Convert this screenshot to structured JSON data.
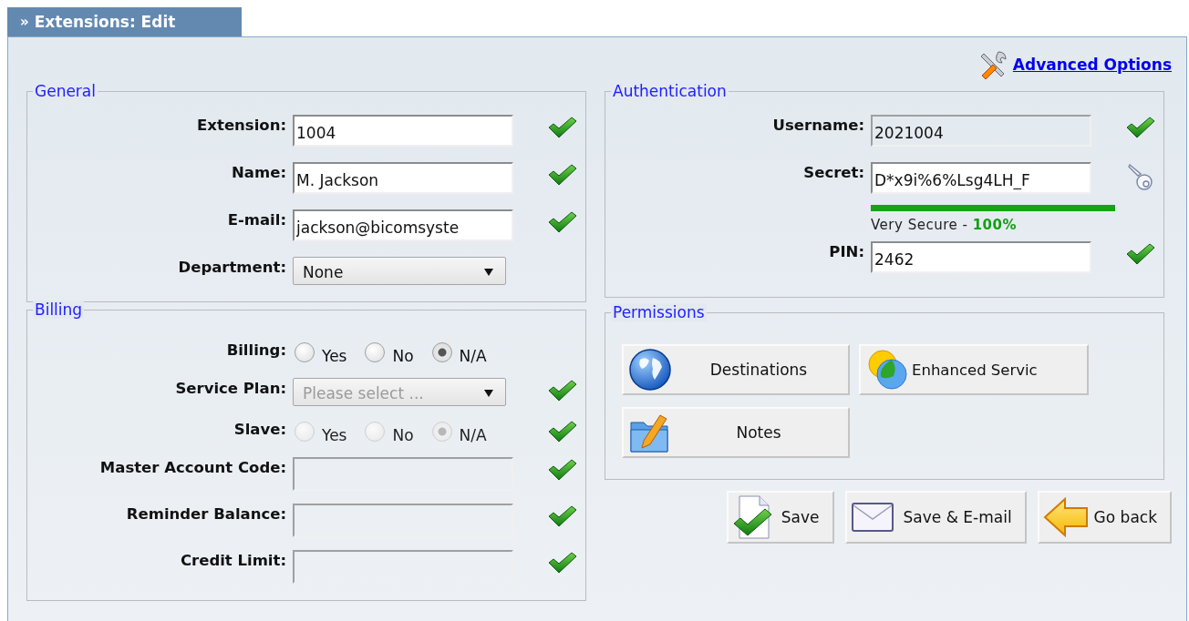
{
  "header": {
    "marker": "»",
    "title": "Extensions: Edit"
  },
  "advanced_link": {
    "label": "Advanced Options"
  },
  "general": {
    "legend": "General",
    "fields": [
      {
        "kind": "text",
        "label": "Extension:",
        "value": "1004",
        "disabled": false,
        "valid": true
      },
      {
        "kind": "text",
        "label": "Name:",
        "value": "M. Jackson",
        "disabled": false,
        "valid": true
      },
      {
        "kind": "text",
        "label": "E-mail:",
        "value": "jackson@bicomsyste",
        "disabled": false,
        "valid": true
      },
      {
        "kind": "select",
        "label": "Department:",
        "value": "None",
        "disabled": false,
        "valid": false
      }
    ]
  },
  "billing": {
    "legend": "Billing",
    "fields": [
      {
        "kind": "radio",
        "label": "Billing:",
        "disabled": false,
        "valid": false,
        "options": [
          {
            "label": "Yes",
            "selected": false
          },
          {
            "label": "No",
            "selected": false
          },
          {
            "label": "N/A",
            "selected": true
          }
        ]
      },
      {
        "kind": "select",
        "label": "Service Plan:",
        "placeholder": "Please select ...",
        "disabled": true,
        "valid": true
      },
      {
        "kind": "radio",
        "label": "Slave:",
        "disabled": true,
        "valid": true,
        "options": [
          {
            "label": "Yes",
            "selected": false
          },
          {
            "label": "No",
            "selected": false
          },
          {
            "label": "N/A",
            "selected": true
          }
        ]
      },
      {
        "kind": "text",
        "label": "Master Account Code:",
        "disabled": true,
        "valid": true
      },
      {
        "kind": "text",
        "label": "Reminder Balance:",
        "disabled": true,
        "valid": true
      },
      {
        "kind": "text",
        "label": "Credit Limit:",
        "disabled": true,
        "valid": true
      }
    ]
  },
  "authentication": {
    "legend": "Authentication",
    "fields": [
      {
        "kind": "text",
        "label": "Username:",
        "value": "2021004",
        "disabled": true,
        "valid": true
      },
      {
        "kind": "secret",
        "label": "Secret:",
        "value": "D*x9i%6%Lsg4LH_F",
        "strength": {
          "level": 1,
          "text": "Very Secure - **100%**"
        }
      },
      {
        "kind": "text",
        "label": "PIN:",
        "value": "2462",
        "disabled": false,
        "valid": true
      }
    ]
  },
  "permissions": {
    "legend": "Permissions",
    "buttons": [
      {
        "kind": "globe",
        "label": "Destinations"
      },
      {
        "kind": "circles",
        "label": "Enhanced Servic"
      },
      {
        "kind": "notes",
        "label": "Notes"
      }
    ]
  },
  "actions": [
    {
      "kind": "save",
      "label": "Save"
    },
    {
      "kind": "email",
      "label": "Save & E-mail"
    },
    {
      "kind": "back",
      "label": "Go back"
    }
  ]
}
